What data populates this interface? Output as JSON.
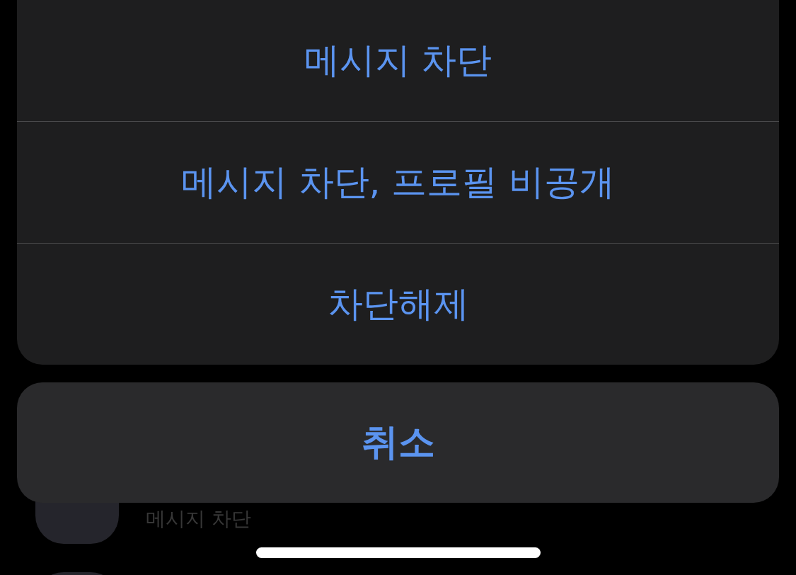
{
  "background_list": {
    "rows": [
      {
        "status": "메시지 차단"
      }
    ]
  },
  "action_sheet": {
    "actions": [
      {
        "label": "메시지 차단"
      },
      {
        "label": "메시지 차단, 프로필 비공개"
      },
      {
        "label": "차단해제"
      }
    ],
    "cancel": {
      "label": "취소"
    }
  }
}
